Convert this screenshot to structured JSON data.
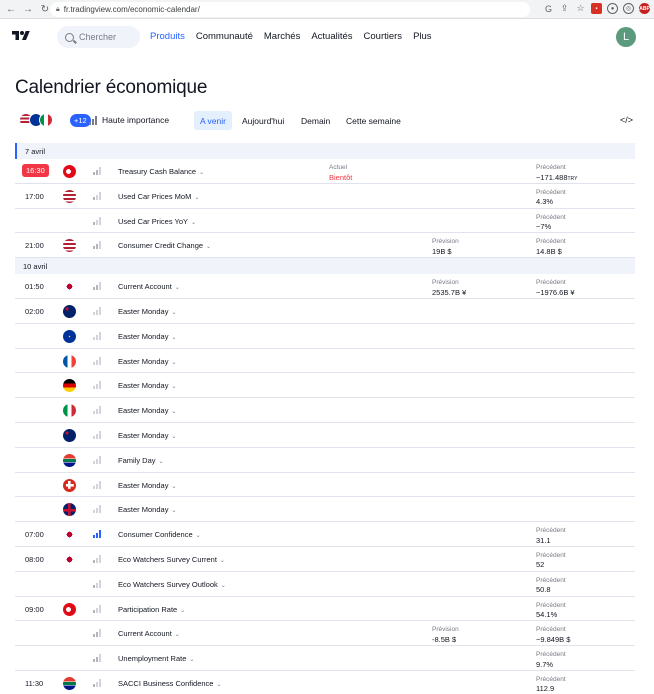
{
  "browser": {
    "url": "fr.tradingview.com/economic-calendar/"
  },
  "header": {
    "search_placeholder": "Chercher",
    "nav": [
      "Produits",
      "Communauté",
      "Marchés",
      "Actualités",
      "Courtiers",
      "Plus"
    ],
    "active_nav": "Produits",
    "avatar_letter": "L",
    "avatar_color": "#5b9a7d"
  },
  "page": {
    "title": "Calendrier économique"
  },
  "filters": {
    "more_count": "+12",
    "importance_label": "Haute importance",
    "tabs": [
      "A venir",
      "Aujourd'hui",
      "Demain",
      "Cette semaine"
    ],
    "active_tab": "A venir",
    "embed_icon": "</>"
  },
  "colors": {
    "accent": "#2962ff",
    "negative": "#f23645",
    "muted": "#787b86"
  },
  "calendar": {
    "day1": "7 avril",
    "day2": "10 avril",
    "r1": {
      "time": "16:30",
      "flag": "tr",
      "event": "Treasury Cash Balance",
      "actual_label": "Actuel",
      "actual_value": "Bientôt",
      "prev_label": "Précédent",
      "prev_value": "−171.488",
      "prev_unit": "TRY"
    },
    "r2": {
      "time": "17:00",
      "flag": "us",
      "event": "Used Car Prices MoM",
      "prev_label": "Précédent",
      "prev_value": "4.3%"
    },
    "r3": {
      "time": "",
      "flag": "us",
      "event": "Used Car Prices YoY",
      "prev_label": "Précédent",
      "prev_value": "−7%"
    },
    "r4": {
      "time": "21:00",
      "flag": "us",
      "event": "Consumer Credit Change",
      "fc_label": "Prévision",
      "fc_value": "19B $",
      "prev_label": "Précédent",
      "prev_value": "14.8B $"
    },
    "r5": {
      "time": "01:50",
      "flag": "jp",
      "event": "Current Account",
      "fc_label": "Prévision",
      "fc_value": "2535.7B ¥",
      "prev_label": "Précédent",
      "prev_value": "−1976.6B ¥"
    },
    "r6": {
      "time": "02:00",
      "flag": "au",
      "event": "Easter Monday"
    },
    "r7": {
      "time": "",
      "flag": "eu",
      "event": "Easter Monday"
    },
    "r8": {
      "time": "",
      "flag": "fr",
      "event": "Easter Monday"
    },
    "r9": {
      "time": "",
      "flag": "de",
      "event": "Easter Monday"
    },
    "r10": {
      "time": "",
      "flag": "it",
      "event": "Easter Monday"
    },
    "r11": {
      "time": "",
      "flag": "nz",
      "event": "Easter Monday"
    },
    "r12": {
      "time": "",
      "flag": "za",
      "event": "Family Day"
    },
    "r13": {
      "time": "",
      "flag": "ch",
      "event": "Easter Monday"
    },
    "r14": {
      "time": "",
      "flag": "gb",
      "event": "Easter Monday"
    },
    "r15": {
      "time": "07:00",
      "flag": "jp",
      "event": "Consumer Confidence",
      "prev_label": "Précédent",
      "prev_value": "31.1"
    },
    "r16": {
      "time": "08:00",
      "flag": "jp",
      "event": "Eco Watchers Survey Current",
      "prev_label": "Précédent",
      "prev_value": "52"
    },
    "r17": {
      "time": "",
      "flag": "jp",
      "event": "Eco Watchers Survey Outlook",
      "prev_label": "Précédent",
      "prev_value": "50.8"
    },
    "r18": {
      "time": "09:00",
      "flag": "tr",
      "event": "Participation Rate",
      "prev_label": "Précédent",
      "prev_value": "54.1%"
    },
    "r19": {
      "time": "",
      "flag": "tr",
      "event": "Current Account",
      "fc_label": "Prévision",
      "fc_value": "-8.5B $",
      "prev_label": "Précédent",
      "prev_value": "−9.849B $"
    },
    "r20": {
      "time": "",
      "flag": "tr",
      "event": "Unemployment Rate",
      "prev_label": "Précédent",
      "prev_value": "9.7%"
    },
    "r21": {
      "time": "11:30",
      "flag": "za",
      "event": "SACCI Business Confidence",
      "prev_label": "Précédent",
      "prev_value": "112.9"
    }
  }
}
